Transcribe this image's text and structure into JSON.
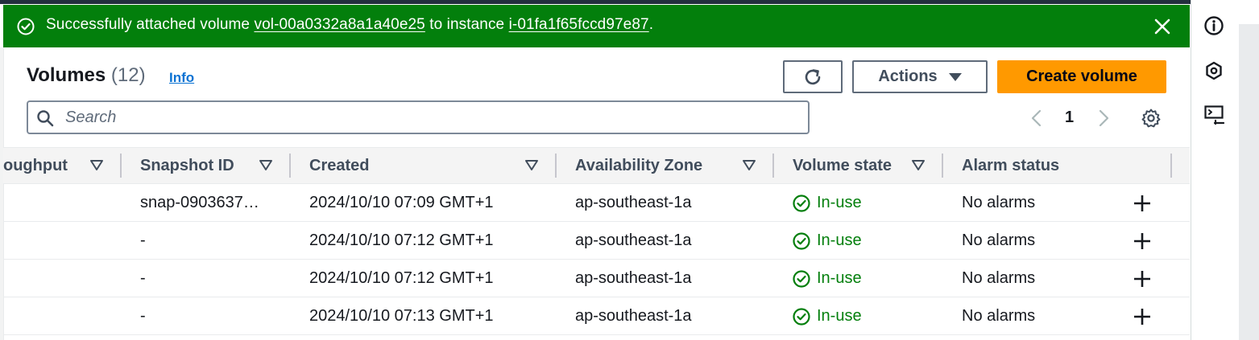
{
  "flash": {
    "prefix": "Successfully attached volume ",
    "volume_link": "vol-00a0332a8a1a40e25",
    "middle": " to instance ",
    "instance_link": "i-01fa1f65fccd97e87",
    "suffix": ".",
    "icon": "check-circle-icon",
    "close_icon": "close-icon"
  },
  "header": {
    "title": "Volumes",
    "count": "(12)",
    "info": "Info",
    "actions_label": "Actions",
    "create_label": "Create volume"
  },
  "search": {
    "placeholder": "Search",
    "value": ""
  },
  "pagination": {
    "current_page": "1"
  },
  "columns": [
    {
      "label": "oughput"
    },
    {
      "label": "Snapshot ID"
    },
    {
      "label": "Created"
    },
    {
      "label": "Availability Zone"
    },
    {
      "label": "Volume state"
    },
    {
      "label": "Alarm status"
    }
  ],
  "rows": [
    {
      "snapshot": "snap-0903637…",
      "created": "2024/10/10 07:09 GMT+1",
      "az": "ap-southeast-1a",
      "state": "In-use",
      "alarm": "No alarms"
    },
    {
      "snapshot": "-",
      "created": "2024/10/10 07:12 GMT+1",
      "az": "ap-southeast-1a",
      "state": "In-use",
      "alarm": "No alarms"
    },
    {
      "snapshot": "-",
      "created": "2024/10/10 07:12 GMT+1",
      "az": "ap-southeast-1a",
      "state": "In-use",
      "alarm": "No alarms"
    },
    {
      "snapshot": "-",
      "created": "2024/10/10 07:13 GMT+1",
      "az": "ap-southeast-1a",
      "state": "In-use",
      "alarm": "No alarms"
    }
  ],
  "colors": {
    "success_green": "#037f0c",
    "primary_orange": "#ff9900",
    "link_blue": "#0972d3"
  },
  "right_panel_icons": [
    "info-icon",
    "security-hub-icon",
    "cloudshell-icon"
  ]
}
